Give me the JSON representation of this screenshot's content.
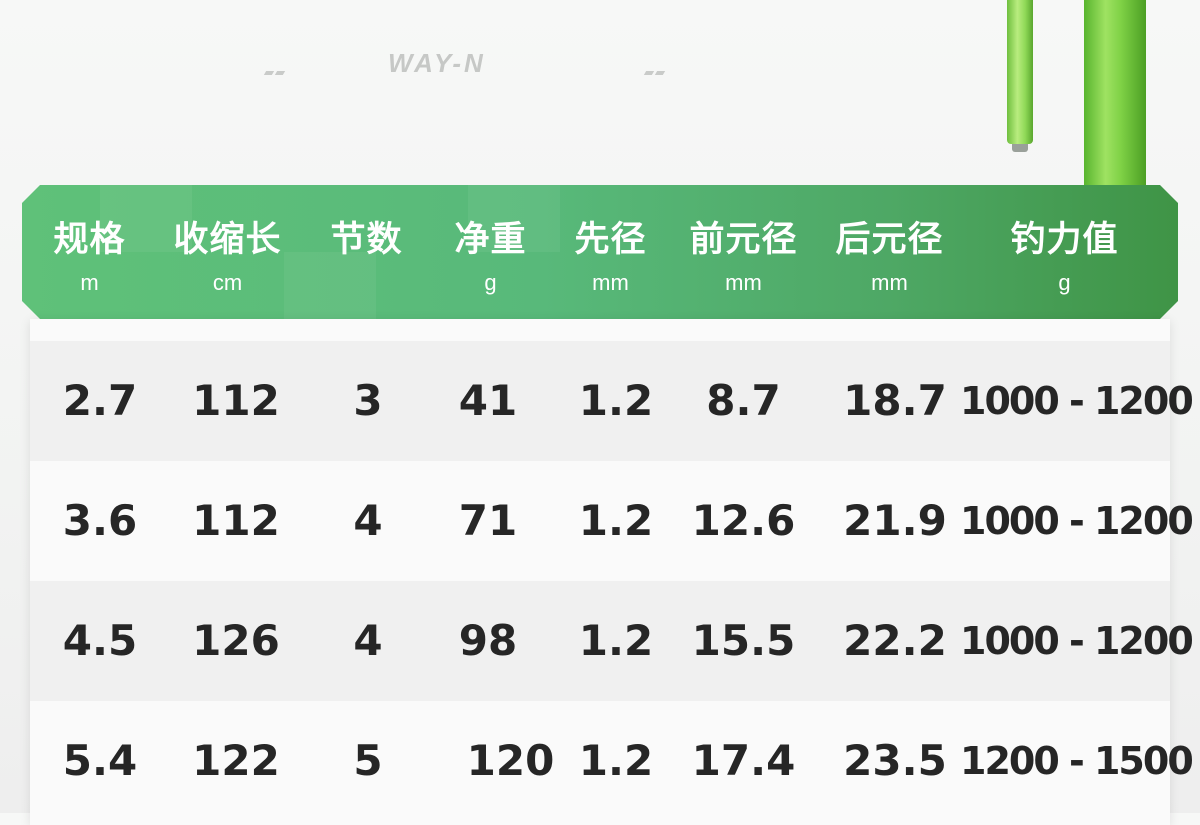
{
  "brand": "WAY-N",
  "table": {
    "columns": [
      {
        "label": "规格",
        "unit": "m"
      },
      {
        "label": "收缩长",
        "unit": "cm"
      },
      {
        "label": "节数",
        "unit": ""
      },
      {
        "label": "净重",
        "unit": "g"
      },
      {
        "label": "先径",
        "unit": "mm"
      },
      {
        "label": "前元径",
        "unit": "mm"
      },
      {
        "label": "后元径",
        "unit": "mm"
      },
      {
        "label": "钓力值",
        "unit": "g"
      }
    ],
    "rows": [
      [
        "2.7",
        "112",
        "3",
        "41",
        "1.2",
        "8.7",
        "18.7",
        "1000 - 1200"
      ],
      [
        "3.6",
        "112",
        "4",
        "71",
        "1.2",
        "12.6",
        "21.9",
        "1000 - 1200"
      ],
      [
        "4.5",
        "126",
        "4",
        "98",
        "1.2",
        "15.5",
        "22.2",
        "1000 - 1200"
      ],
      [
        "5.4",
        "122",
        "5",
        "120",
        "1.2",
        "17.4",
        "23.5",
        "1200 - 1500"
      ]
    ]
  },
  "colors": {
    "header_green": "#58b97a",
    "text_dark": "#262626",
    "rod_green": "#7ed145"
  }
}
